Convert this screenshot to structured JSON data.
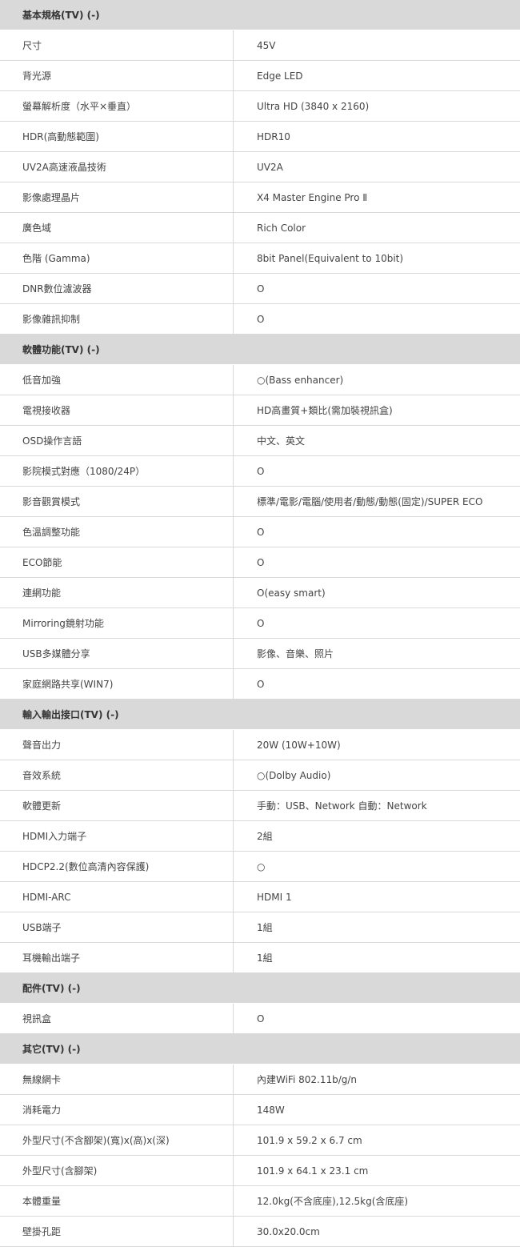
{
  "sections": [
    {
      "title": "基本規格(TV) (-)",
      "rows": [
        {
          "label": "尺寸",
          "value": "45V"
        },
        {
          "label": "背光源",
          "value": "Edge LED"
        },
        {
          "label": "螢幕解析度（水平×垂直）",
          "value": "Ultra HD (3840 x 2160)"
        },
        {
          "label": "HDR(高動態範圍)",
          "value": "HDR10"
        },
        {
          "label": "UV2A高速液晶技術",
          "value": "UV2A"
        },
        {
          "label": "影像處理晶片",
          "value": "X4 Master Engine Pro Ⅱ"
        },
        {
          "label": "廣色域",
          "value": "Rich Color"
        },
        {
          "label": "色階 (Gamma)",
          "value": "8bit Panel(Equivalent to 10bit)"
        },
        {
          "label": "DNR數位濾波器",
          "value": "O"
        },
        {
          "label": "影像雜訊抑制",
          "value": "O"
        }
      ]
    },
    {
      "title": "軟體功能(TV) (-)",
      "rows": [
        {
          "label": "低音加強",
          "value": "○(Bass enhancer)"
        },
        {
          "label": "電視接收器",
          "value": "HD高畫質+類比(需加裝視訊盒)"
        },
        {
          "label": "OSD操作言語",
          "value": "中文、英文"
        },
        {
          "label": "影院模式對應（1080/24P）",
          "value": "O"
        },
        {
          "label": "影音觀賞模式",
          "value": "標準/電影/電腦/使用者/動態/動態(固定)/SUPER ECO"
        },
        {
          "label": "色溫調整功能",
          "value": "O"
        },
        {
          "label": "ECO節能",
          "value": "O"
        },
        {
          "label": "連網功能",
          "value": "O(easy smart)"
        },
        {
          "label": "Mirroring鏡射功能",
          "value": "O"
        },
        {
          "label": "USB多媒體分享",
          "value": "影像、音樂、照片"
        },
        {
          "label": "家庭網路共享(WIN7)",
          "value": "O"
        }
      ]
    },
    {
      "title": "輸入輸出接口(TV) (-)",
      "rows": [
        {
          "label": "聲音出力",
          "value": "20W (10W+10W)"
        },
        {
          "label": "音效系統",
          "value": "○(Dolby Audio)"
        },
        {
          "label": "軟體更新",
          "value": "手動：USB、Network 自動：Network"
        },
        {
          "label": "HDMI入力端子",
          "value": "2組"
        },
        {
          "label": "HDCP2.2(數位高清內容保護)",
          "value": "○"
        },
        {
          "label": "HDMI-ARC",
          "value": "HDMI 1"
        },
        {
          "label": "USB端子",
          "value": "1組"
        },
        {
          "label": "耳機輸出端子",
          "value": "1組"
        }
      ]
    },
    {
      "title": "配件(TV) (-)",
      "rows": [
        {
          "label": "視訊盒",
          "value": "O"
        }
      ]
    },
    {
      "title": "其它(TV) (-)",
      "rows": [
        {
          "label": "無線網卡",
          "value": "內建WiFi 802.11b/g/n"
        },
        {
          "label": "消耗電力",
          "value": "148W"
        },
        {
          "label": "外型尺寸(不含腳架)(寬)x(高)x(深)",
          "value": "101.9 x 59.2 x 6.7 cm"
        },
        {
          "label": "外型尺寸(含腳架)",
          "value": "101.9 x 64.1 x 23.1 cm"
        },
        {
          "label": "本體重量",
          "value": "12.0kg(不含底座),12.5kg(含底座)"
        },
        {
          "label": "壁掛孔距",
          "value": "30.0x20.0cm"
        }
      ]
    }
  ]
}
